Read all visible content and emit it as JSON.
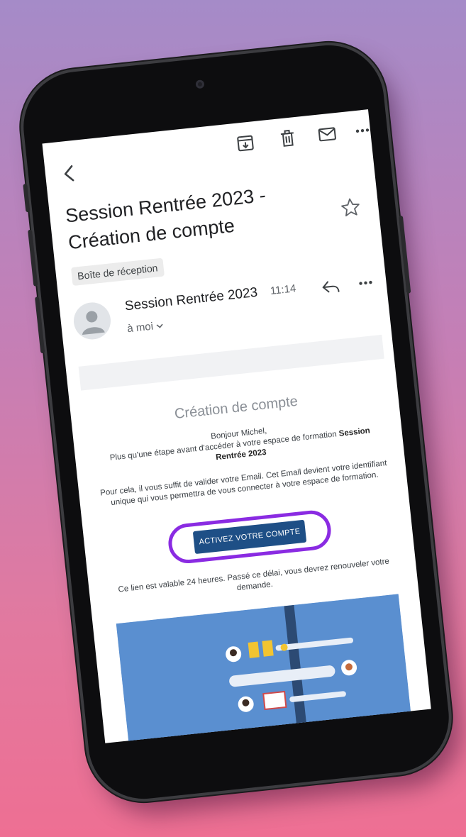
{
  "toolbar": {
    "archive_icon": "archive-icon",
    "delete_icon": "trash-icon",
    "mark_unread_icon": "mail-icon",
    "more_icon": "more-horizontal-icon"
  },
  "email": {
    "subject": "Session Rentrée 2023 - Création de compte",
    "label": "Boîte de réception",
    "sender": "Session Rentrée 2023",
    "time": "11:14",
    "recipient": "à moi",
    "body": {
      "heading": "Création de compte",
      "greeting": "Bonjour Michel,",
      "line1_pre": "Plus qu'une étape avant d'accéder à votre espace de formation ",
      "line1_bold": "Session Rentrée 2023",
      "line2": "Pour cela, il vous suffit de valider votre Email. Cet Email devient votre identifiant unique qui vous permettra de vous connecter à votre espace de formation.",
      "cta_label": "ACTIVEZ VOTRE COMPTE",
      "validity": "Ce lien est valable 24 heures. Passé ce délai, vous devrez renouveler votre demande."
    }
  },
  "colors": {
    "cta": "#1e4f86",
    "highlight_ring": "#8a2be2",
    "illustration_bg": "#5a8fd0"
  }
}
